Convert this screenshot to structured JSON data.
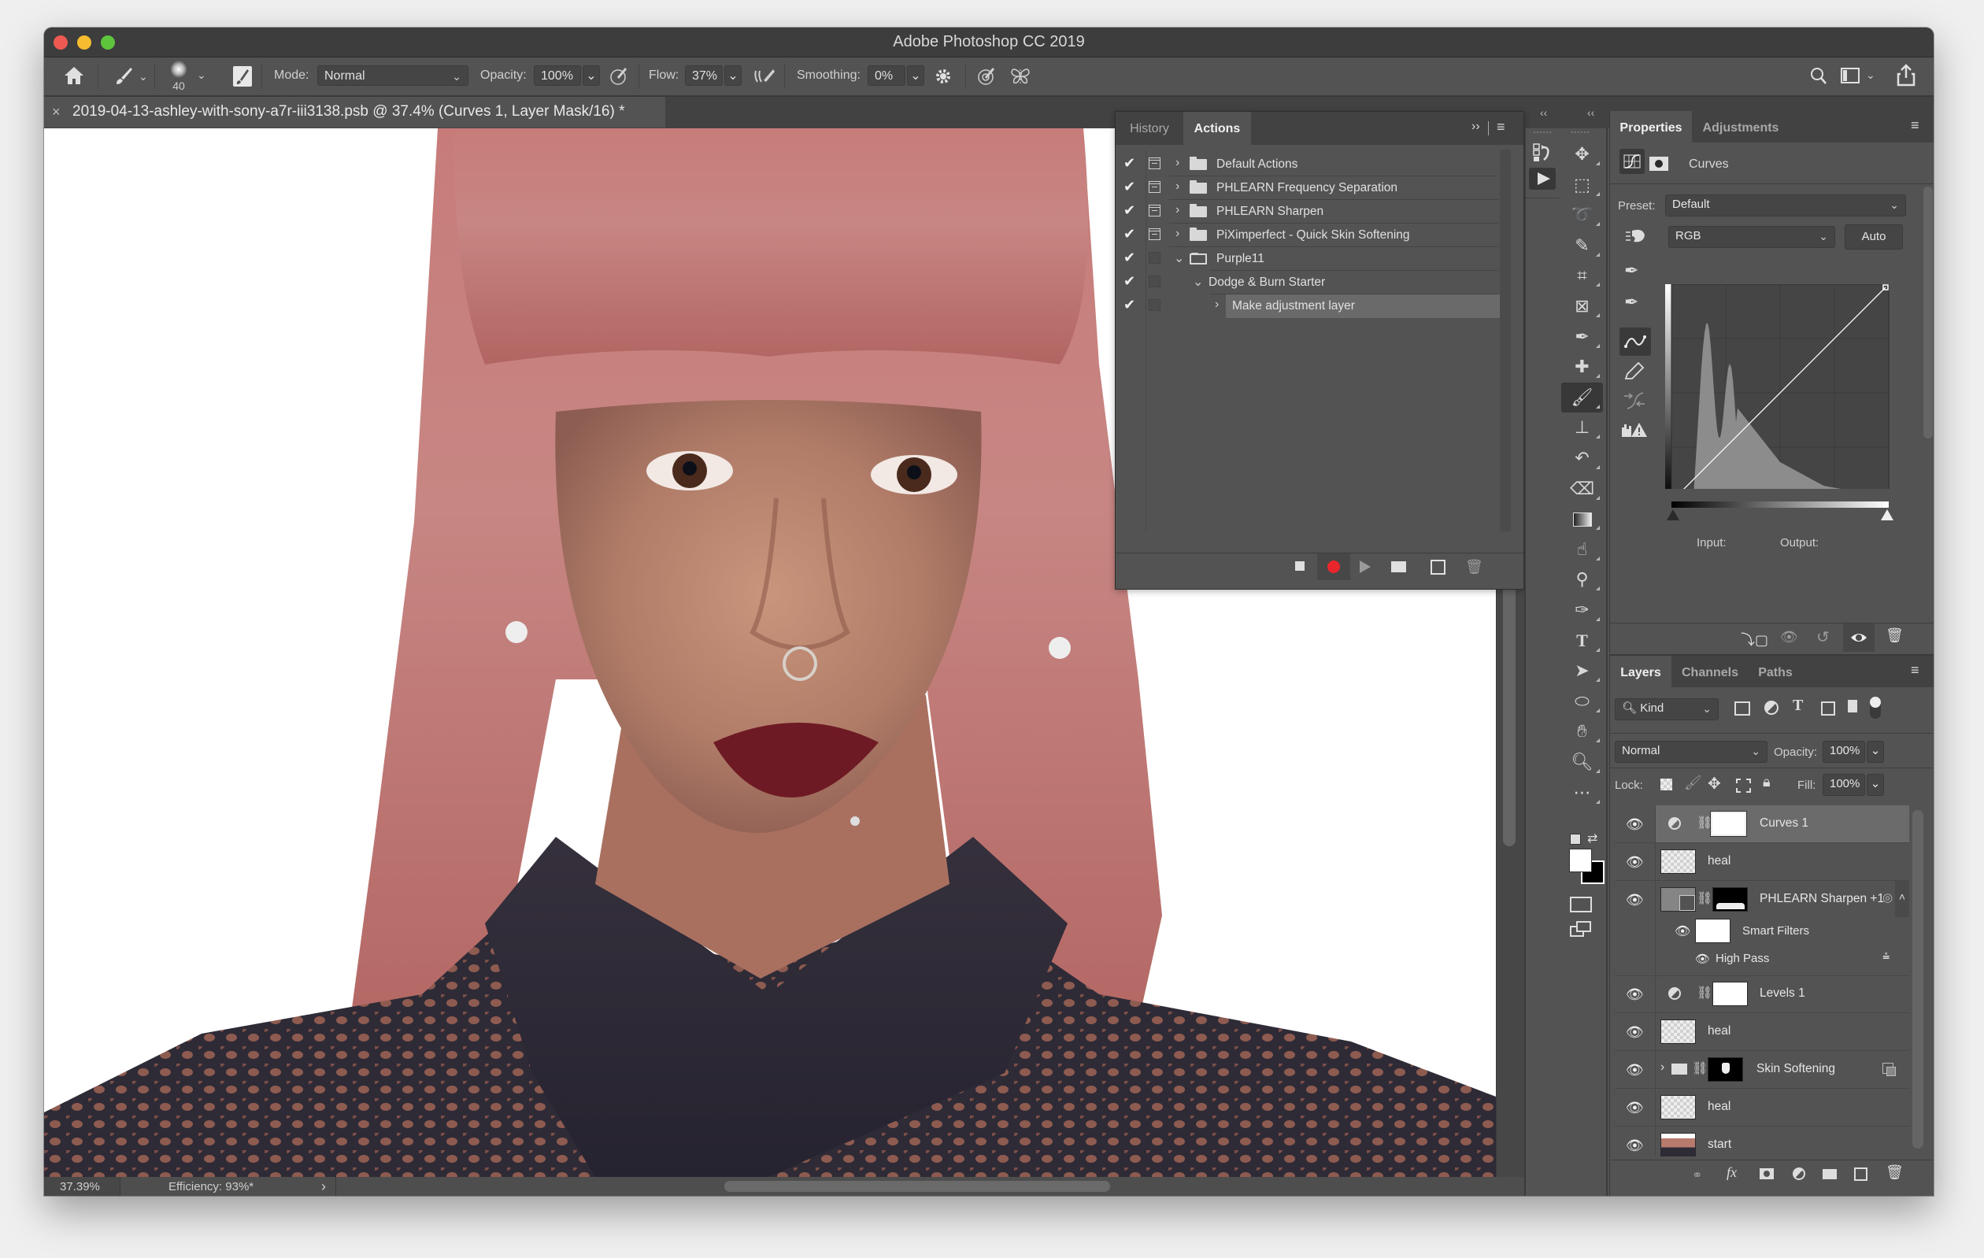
{
  "window": {
    "title": "Adobe Photoshop CC 2019",
    "traffic_lights": {
      "close": "#ee5a52",
      "minimize": "#f5bd2f",
      "zoom": "#5fc43d"
    }
  },
  "options_bar": {
    "home_icon": "home-icon",
    "tool_icon": "brush-icon",
    "brush_size": "40",
    "mode_label": "Mode:",
    "mode_value": "Normal",
    "opacity_label": "Opacity:",
    "opacity_value": "100%",
    "flow_label": "Flow:",
    "flow_value": "37%",
    "smoothing_label": "Smoothing:",
    "smoothing_value": "0%"
  },
  "document_tab": {
    "close": "×",
    "title": "2019-04-13-ashley-with-sony-a7r-iii3138.psb @ 37.4% (Curves 1, Layer Mask/16) *"
  },
  "status_bar": {
    "zoom": "37.39%",
    "info": "Efficiency: 93%*",
    "arrow": "›"
  },
  "actions_panel": {
    "tabs": [
      {
        "label": "History",
        "active": false
      },
      {
        "label": "Actions",
        "active": true
      }
    ],
    "items": [
      {
        "label": "Default Actions",
        "checked": true,
        "dialog": true,
        "expanded": false,
        "type": "set",
        "indent": 0
      },
      {
        "label": "PHLEARN Frequency Separation",
        "checked": true,
        "dialog": true,
        "expanded": false,
        "type": "set",
        "indent": 0
      },
      {
        "label": "PHLEARN Sharpen",
        "checked": true,
        "dialog": true,
        "expanded": false,
        "type": "set",
        "indent": 0
      },
      {
        "label": "PiXimperfect - Quick Skin Softening",
        "checked": true,
        "dialog": true,
        "expanded": false,
        "type": "set",
        "indent": 0
      },
      {
        "label": "Purple11",
        "checked": true,
        "dialog": false,
        "expanded": true,
        "type": "set",
        "indent": 0
      },
      {
        "label": "Dodge & Burn Starter",
        "checked": true,
        "dialog": false,
        "expanded": true,
        "type": "action",
        "indent": 1
      },
      {
        "label": "Make adjustment layer",
        "checked": true,
        "dialog": false,
        "expanded": false,
        "type": "command",
        "indent": 2,
        "selected": true
      }
    ],
    "footer_buttons": [
      "stop-icon",
      "record-icon",
      "play-icon",
      "folder-icon",
      "new-action-icon",
      "trash-icon"
    ],
    "record_color": "#e8262b"
  },
  "properties_panel": {
    "tabs": [
      {
        "label": "Properties",
        "active": true
      },
      {
        "label": "Adjustments",
        "active": false
      }
    ],
    "adjustment_name": "Curves",
    "preset_label": "Preset:",
    "preset_value": "Default",
    "channel_value": "RGB",
    "auto_label": "Auto",
    "input_label": "Input:",
    "output_label": "Output:"
  },
  "layers_panel": {
    "tabs": [
      {
        "label": "Layers",
        "active": true
      },
      {
        "label": "Channels",
        "active": false
      },
      {
        "label": "Paths",
        "active": false
      }
    ],
    "filter_label": "Kind",
    "blend_mode": "Normal",
    "opacity_label": "Opacity:",
    "opacity_value": "100%",
    "lock_label": "Lock:",
    "fill_label": "Fill:",
    "fill_value": "100%",
    "layers": [
      {
        "name": "Curves 1",
        "type": "adjustment",
        "selected": true
      },
      {
        "name": "heal",
        "type": "pixel"
      },
      {
        "name": "PHLEARN Sharpen +1",
        "type": "smart"
      },
      {
        "name": "Smart Filters",
        "type": "smart-filters"
      },
      {
        "name": "High Pass",
        "type": "filter"
      },
      {
        "name": "Levels 1",
        "type": "adjustment"
      },
      {
        "name": "heal",
        "type": "pixel"
      },
      {
        "name": "Skin Softening",
        "type": "group"
      },
      {
        "name": "heal",
        "type": "pixel"
      },
      {
        "name": "start",
        "type": "photo"
      }
    ]
  },
  "toolbar": {
    "tools": [
      "move-tool",
      "marquee-tool",
      "lasso-tool",
      "quick-select-tool",
      "crop-tool",
      "frame-tool",
      "eyedropper-tool",
      "healing-tool",
      "brush-tool",
      "stamp-tool",
      "history-brush-tool",
      "eraser-tool",
      "gradient-tool",
      "smudge-tool",
      "dodge-tool",
      "pen-tool",
      "type-tool",
      "path-select-tool",
      "ellipse-tool",
      "hand-tool",
      "zoom-tool",
      "more-tools"
    ],
    "active_tool": "brush-tool",
    "foreground": "#ffffff",
    "background": "#000000"
  }
}
